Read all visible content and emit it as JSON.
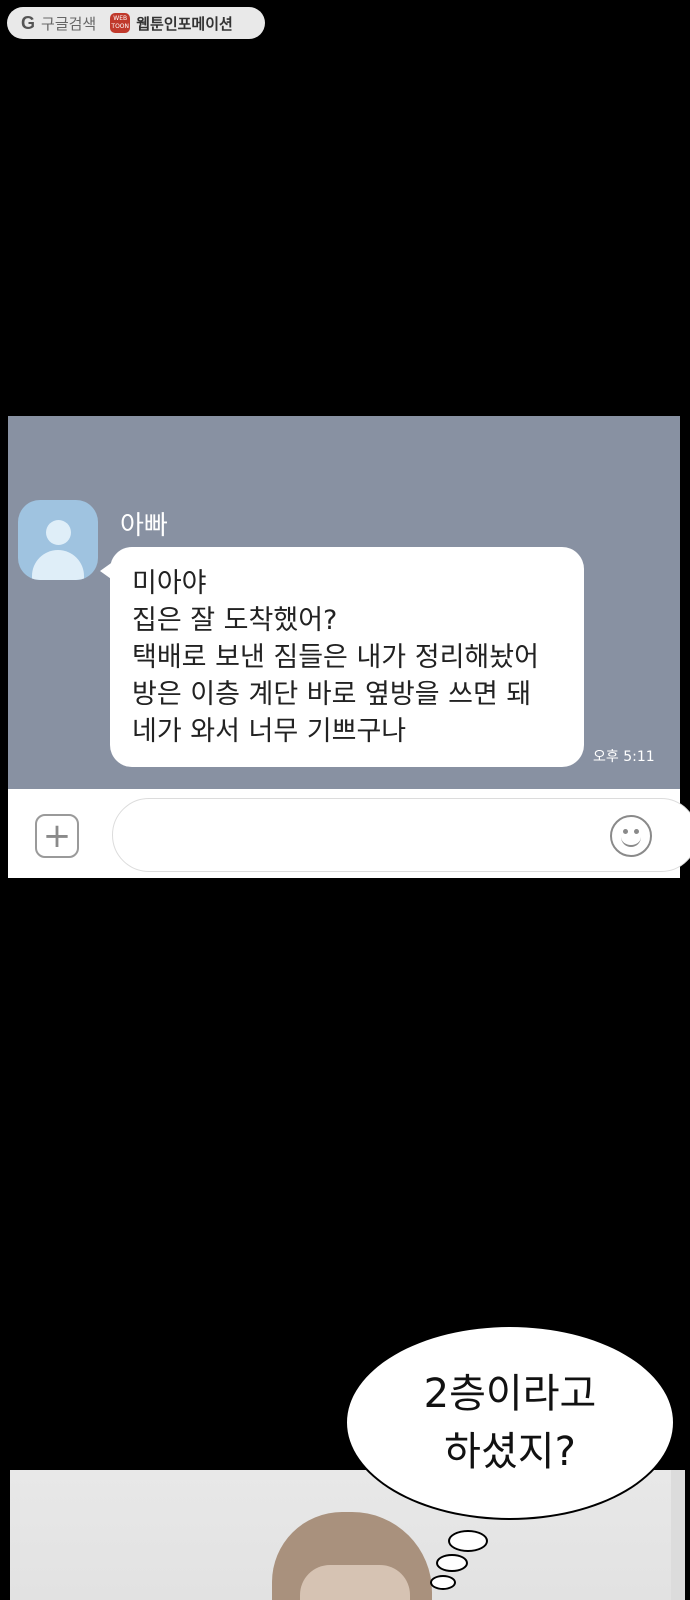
{
  "topbar": {
    "google_label": "구글검색",
    "webtoon_label": "웹툰인포메이션",
    "webtoon_logo_text": "WEB TOON"
  },
  "chat": {
    "sender": "아빠",
    "message_lines": [
      "미아야",
      "집은 잘 도착했어?",
      "택배로 보낸 짐들은 내가 정리해놨어",
      "방은 이층 계단 바로 옆방을 쓰면 돼",
      "네가 와서 너무 기쁘구나"
    ],
    "time": "오후 5:11",
    "plus_symbol": "+"
  },
  "speech": {
    "lines": [
      "2층이라고",
      "하셨지?"
    ]
  },
  "colors": {
    "chat_background": "#8891a2",
    "page_background": "#000000"
  }
}
